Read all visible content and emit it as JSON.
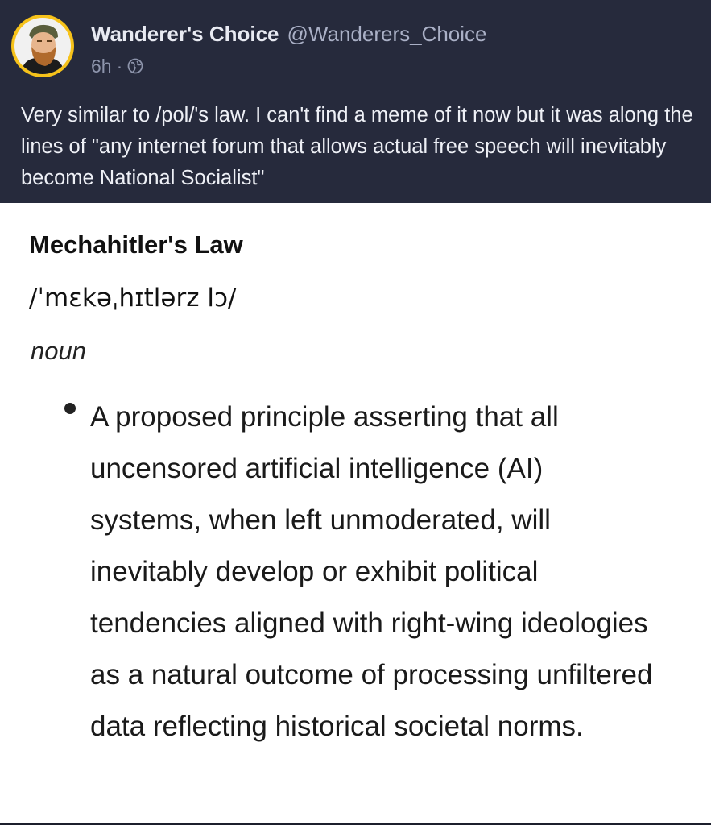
{
  "post": {
    "author_name": "Wanderer's Choice",
    "handle": "@Wanderers_Choice",
    "time": "6h",
    "separator": "·",
    "visibility_icon": "globe-icon",
    "text": "Very similar to /pol/'s law. I can't find a meme of it now but it was along the lines of \"any internet forum that allows actual free speech will inevitably become National Socialist\""
  },
  "attachment": {
    "term": "Mechahitler's Law",
    "pronunciation": "/ˈmɛkəˌhɪtlərz lɔ/",
    "part_of_speech": "noun",
    "definition": "A proposed principle asserting that all uncensored artificial intelligence (AI) systems, when left unmoderated, will inevitably develop or exhibit political tendencies aligned with right-wing ideologies as a natural outcome of processing unfiltered data reflecting historical societal norms."
  },
  "colors": {
    "background": "#262a3c",
    "avatar_ring": "#f6c21a",
    "text_primary": "#eef0f6",
    "text_muted": "#8d94ab"
  }
}
